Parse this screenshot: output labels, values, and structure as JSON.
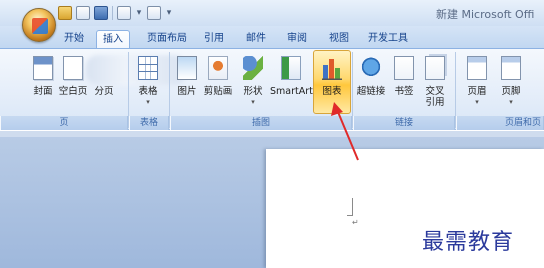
{
  "window": {
    "title": "新建 Microsoft Offi"
  },
  "quick_access": {
    "icons": [
      "new-doc-icon",
      "open-folder-icon",
      "save-icon",
      "undo-icon",
      "redo-icon",
      "customize-icon"
    ]
  },
  "tabs": [
    "开始",
    "插入",
    "页面布局",
    "引用",
    "邮件",
    "审阅",
    "视图",
    "开发工具"
  ],
  "active_tab": "插入",
  "ribbon": {
    "pages": {
      "cover": "封面",
      "blank": "空白页",
      "break": "分页",
      "label": "页"
    },
    "tables": {
      "table": "表格",
      "label": "表格"
    },
    "illustrations": {
      "picture": "图片",
      "clipart": "剪贴画",
      "shapes": "形状",
      "smartart": "SmartArt",
      "chart": "图表",
      "label": "插图"
    },
    "links": {
      "hyperlink": "超链接",
      "bookmark": "书签",
      "crossref": "交叉\n引用",
      "label": "链接"
    },
    "header_footer": {
      "header": "页眉",
      "footer": "页脚",
      "label": "页眉和页"
    }
  },
  "colors": {
    "accent": "#15428b",
    "highlight": "#ffc73c",
    "arrow": "#e02a2a"
  },
  "watermark": "最需教育"
}
